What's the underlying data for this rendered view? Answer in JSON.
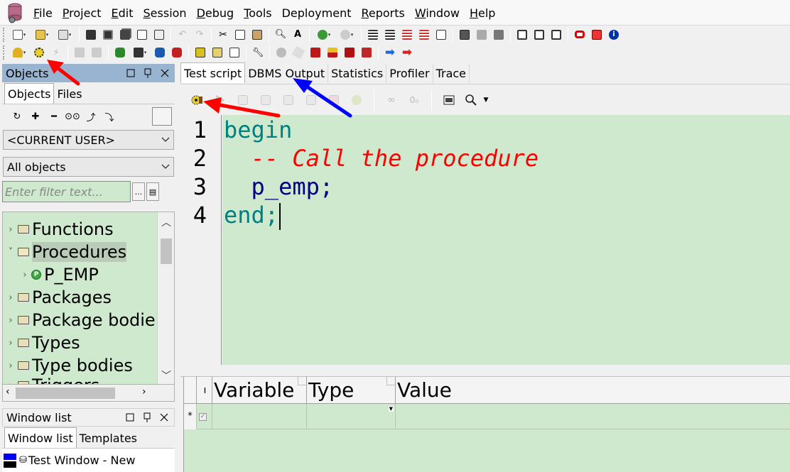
{
  "menubar": {
    "items": [
      {
        "label": "File",
        "u": "F",
        "rest": "ile"
      },
      {
        "label": "Project",
        "u": "P",
        "rest": "roject"
      },
      {
        "label": "Edit",
        "u": "E",
        "rest": "dit"
      },
      {
        "label": "Session",
        "u": "S",
        "rest": "ession"
      },
      {
        "label": "Debug",
        "u": "D",
        "rest": "ebug"
      },
      {
        "label": "Tools",
        "u": "T",
        "rest": "ools"
      },
      {
        "label": "Deployment",
        "u": "",
        "rest": "Deployment"
      },
      {
        "label": "Reports",
        "u": "R",
        "rest": "eports"
      },
      {
        "label": "Window",
        "u": "W",
        "rest": "indow"
      },
      {
        "label": "Help",
        "u": "H",
        "rest": "elp"
      }
    ]
  },
  "objects_panel": {
    "title": "Objects",
    "tabs": [
      "Objects",
      "Files"
    ],
    "user_combo": "<CURRENT USER>",
    "type_combo": "All objects",
    "filter_placeholder": "Enter filter text...",
    "filter_btn": "...",
    "tree": [
      {
        "label": "Functions",
        "expander": "›",
        "icon": "folder"
      },
      {
        "label": "Procedures",
        "expander": "˅",
        "icon": "folder-open",
        "selected": true
      },
      {
        "label": "P_EMP",
        "expander": "›",
        "icon": "procedure"
      },
      {
        "label": "Packages",
        "expander": "›",
        "icon": "folder"
      },
      {
        "label": "Package bodie",
        "expander": "›",
        "icon": "folder"
      },
      {
        "label": "Types",
        "expander": "›",
        "icon": "folder"
      },
      {
        "label": "Type bodies",
        "expander": "›",
        "icon": "folder"
      },
      {
        "label": "Triggers",
        "expander": "›",
        "icon": "folder"
      }
    ]
  },
  "window_list": {
    "title": "Window list",
    "tabs": [
      "Window list",
      "Templates"
    ],
    "entry": "Test Window - New"
  },
  "editor": {
    "tabs": [
      "Test script",
      "DBMS Output",
      "Statistics",
      "Profiler",
      "Trace"
    ],
    "active_tab": "Test script",
    "line_numbers": [
      "1",
      "2",
      "3",
      "4"
    ],
    "code": {
      "line1": "begin",
      "line2_indent": "  ",
      "line2_comment": "-- Call the procedure",
      "line3": "  p_emp;",
      "line4": "end;"
    }
  },
  "variables": {
    "headers": [
      "Variable",
      "Type",
      "Value"
    ],
    "new_row_marker": "*"
  },
  "colors": {
    "editor_bg": "#cfe9cf",
    "keyword": "#008080",
    "comment": "#ff0000",
    "panel_title": "#99b4d1",
    "arrow_red": "#ff0000",
    "arrow_blue": "#0000ff"
  }
}
